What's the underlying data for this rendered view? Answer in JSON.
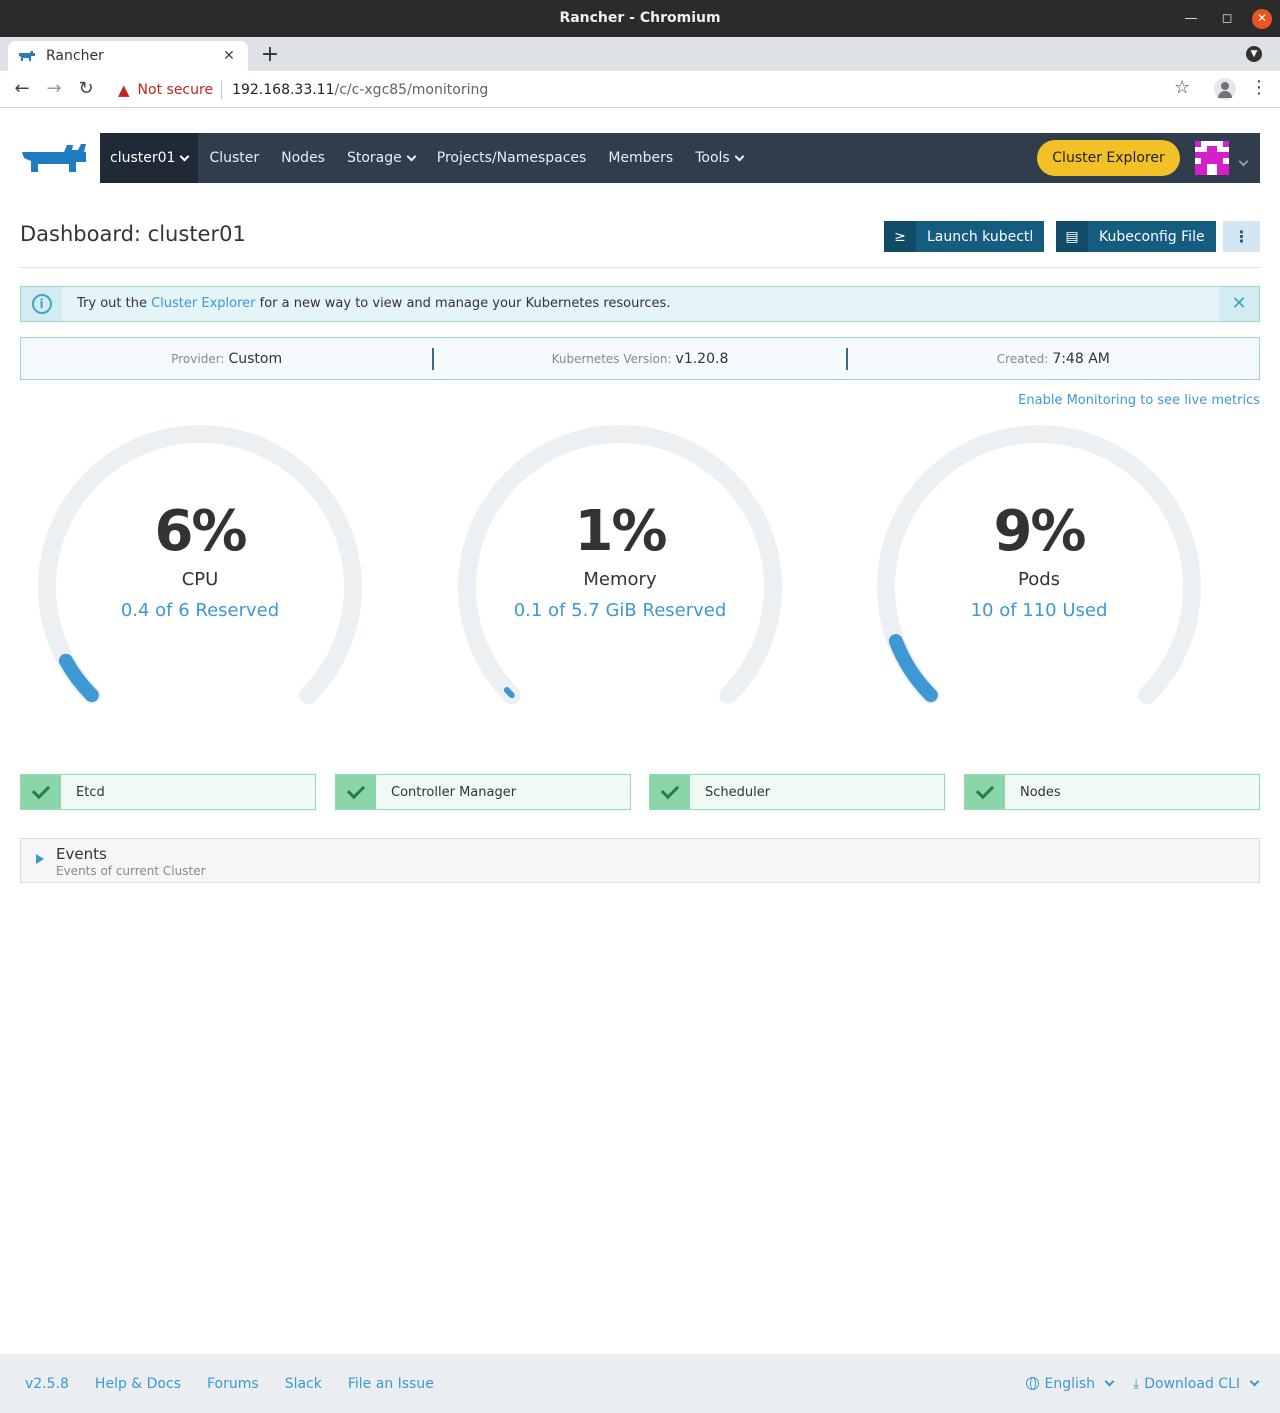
{
  "browser": {
    "window_title": "Rancher - Chromium",
    "tab_title": "Rancher",
    "not_secure": "Not secure",
    "url_host": "192.168.33.11",
    "url_path": "/c/c-xgc85/monitoring"
  },
  "nav": {
    "cluster": "cluster01",
    "items": [
      {
        "label": "Cluster",
        "dropdown": false
      },
      {
        "label": "Nodes",
        "dropdown": false
      },
      {
        "label": "Storage",
        "dropdown": true
      },
      {
        "label": "Projects/Namespaces",
        "dropdown": false
      },
      {
        "label": "Members",
        "dropdown": false
      },
      {
        "label": "Tools",
        "dropdown": true
      }
    ],
    "cluster_explorer": "Cluster Explorer"
  },
  "dashboard": {
    "title": "Dashboard: cluster01",
    "launch_kubectl": "Launch kubectl",
    "kubeconfig": "Kubeconfig File"
  },
  "banner": {
    "prefix": "Try out the",
    "link": "Cluster Explorer",
    "suffix": "for a new way to view and manage your Kubernetes resources."
  },
  "info": {
    "provider_label": "Provider:",
    "provider": "Custom",
    "k8s_label": "Kubernetes Version:",
    "k8s": "v1.20.8",
    "created_label": "Created:",
    "created": "7:48 AM"
  },
  "enable_monitoring": "Enable Monitoring to see live metrics",
  "gauges": [
    {
      "pct": "6%",
      "label": "CPU",
      "sub": "0.4 of 6 Reserved",
      "value": 0.06
    },
    {
      "pct": "1%",
      "label": "Memory",
      "sub": "0.1 of 5.7 GiB Reserved",
      "value": 0.01
    },
    {
      "pct": "9%",
      "label": "Pods",
      "sub": "10 of 110 Used",
      "value": 0.09
    }
  ],
  "health": [
    "Etcd",
    "Controller Manager",
    "Scheduler",
    "Nodes"
  ],
  "events": {
    "title": "Events",
    "subtitle": "Events of current Cluster"
  },
  "footer": {
    "version": "v2.5.8",
    "links": [
      "Help & Docs",
      "Forums",
      "Slack",
      "File an Issue"
    ],
    "language": "English",
    "download": "Download CLI"
  },
  "colors": {
    "navbar": "#2f3d4c",
    "accent": "#3d98d3",
    "cluster_explorer": "#f3c125",
    "gauge_track": "#edf0f2",
    "gauge_fill": "#3d98d3"
  }
}
